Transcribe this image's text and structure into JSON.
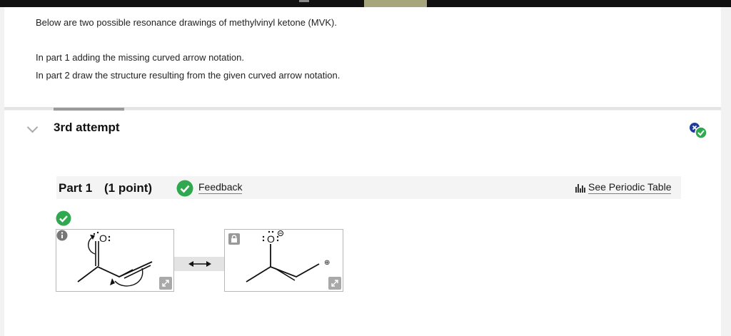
{
  "instructions": {
    "intro": "Below are two possible resonance drawings of methylvinyl ketone (MVK).",
    "line1": "In part 1 adding the missing curved arrow notation.",
    "line2": "In part 2 draw the structure resulting from the given curved arrow notation."
  },
  "attempt": {
    "title": "3rd attempt"
  },
  "part": {
    "title": "Part 1",
    "points": "(1 point)",
    "feedback_label": "Feedback",
    "periodic_table_label": "See Periodic Table"
  },
  "structures": {
    "left": {
      "atom_label": "O"
    },
    "right": {
      "atom_label": "O",
      "charge_label": "⊕"
    }
  },
  "icons": {
    "status": "x-and-check-badge-icon",
    "part_status": "check-circle-icon",
    "periodic_table": "chart-icon",
    "info": "info-icon",
    "expand": "expand-icon",
    "lock": "lock-icon"
  },
  "colors": {
    "success_green": "#2fa84f",
    "error_blue": "#1e3c9a",
    "link_underline": "#3b8fd9"
  }
}
